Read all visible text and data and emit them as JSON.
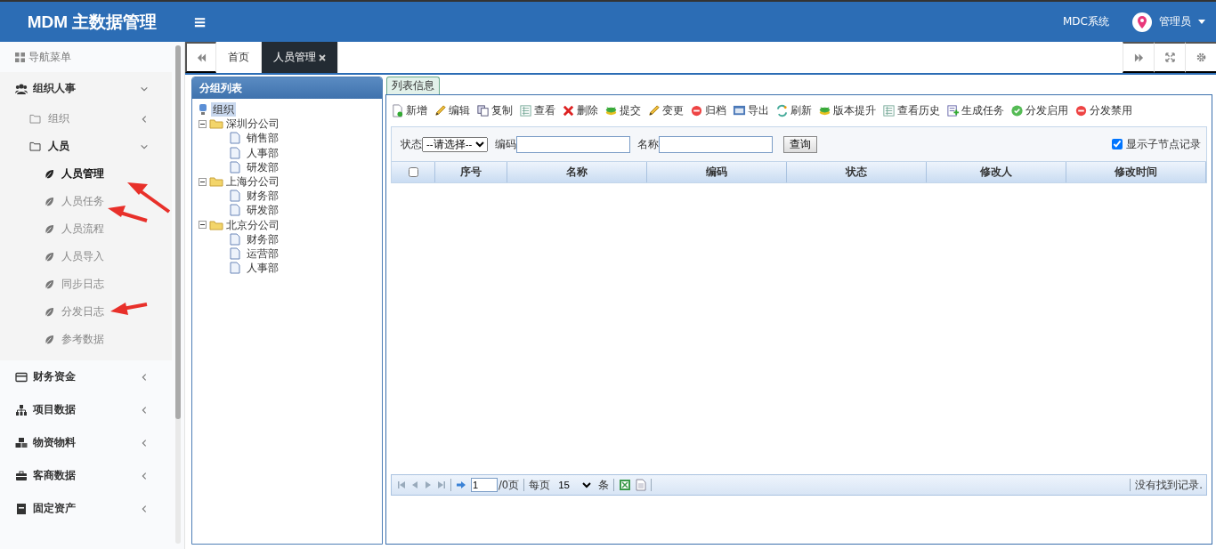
{
  "header": {
    "title": "MDM 主数据管理",
    "menu_glyph": "≡",
    "system": "MDC系统",
    "user": "管理员"
  },
  "sidebar": {
    "heading": "导航菜单",
    "groups": [
      {
        "label": "组织人事",
        "expanded": true,
        "children": [
          {
            "label": "组织",
            "expanded": false
          },
          {
            "label": "人员",
            "expanded": true,
            "children": [
              {
                "label": "人员管理",
                "selected": true
              },
              {
                "label": "人员任务",
                "selected": false
              },
              {
                "label": "人员流程",
                "selected": false
              },
              {
                "label": "人员导入",
                "selected": false
              },
              {
                "label": "同步日志",
                "selected": false
              },
              {
                "label": "分发日志",
                "selected": false
              },
              {
                "label": "参考数据",
                "selected": false
              }
            ]
          }
        ]
      },
      {
        "label": "财务资金",
        "expanded": false
      },
      {
        "label": "项目数据",
        "expanded": false
      },
      {
        "label": "物资物料",
        "expanded": false
      },
      {
        "label": "客商数据",
        "expanded": false
      },
      {
        "label": "固定资产",
        "expanded": false
      }
    ]
  },
  "tabs": [
    {
      "label": "首页",
      "selected": false,
      "closable": false
    },
    {
      "label": "人员管理",
      "selected": true,
      "closable": true
    }
  ],
  "tree_panel": {
    "title": "分组列表",
    "root": {
      "label": "组织",
      "selected": true,
      "children": [
        {
          "label": "深圳分公司",
          "expanded": true,
          "children": [
            {
              "label": "销售部"
            },
            {
              "label": "人事部"
            },
            {
              "label": "研发部"
            }
          ]
        },
        {
          "label": "上海分公司",
          "expanded": true,
          "children": [
            {
              "label": "财务部"
            },
            {
              "label": "研发部"
            }
          ]
        },
        {
          "label": "北京分公司",
          "expanded": true,
          "children": [
            {
              "label": "财务部"
            },
            {
              "label": "运营部"
            },
            {
              "label": "人事部"
            }
          ]
        }
      ]
    }
  },
  "list_panel": {
    "tab": "列表信息",
    "toolbar": [
      "新增",
      "编辑",
      "复制",
      "查看",
      "删除",
      "提交",
      "变更",
      "归档",
      "导出",
      "刷新",
      "版本提升",
      "查看历史",
      "生成任务",
      "分发启用",
      "分发禁用"
    ],
    "filters": {
      "status_label": "状态",
      "status_value": "--请选择--",
      "code_label": "编码",
      "name_label": "名称",
      "query_button": "查询",
      "show_children": {
        "label": "显示子节点记录",
        "checked": true
      }
    },
    "table": {
      "select_all": false,
      "columns": [
        "序号",
        "名称",
        "编码",
        "状态",
        "修改人",
        "修改时间"
      ]
    },
    "pager": {
      "page": "1",
      "total_pages": "/0页",
      "per_page_label": "每页",
      "per_page": "15",
      "unit": "条",
      "status": "没有找到记录."
    }
  }
}
